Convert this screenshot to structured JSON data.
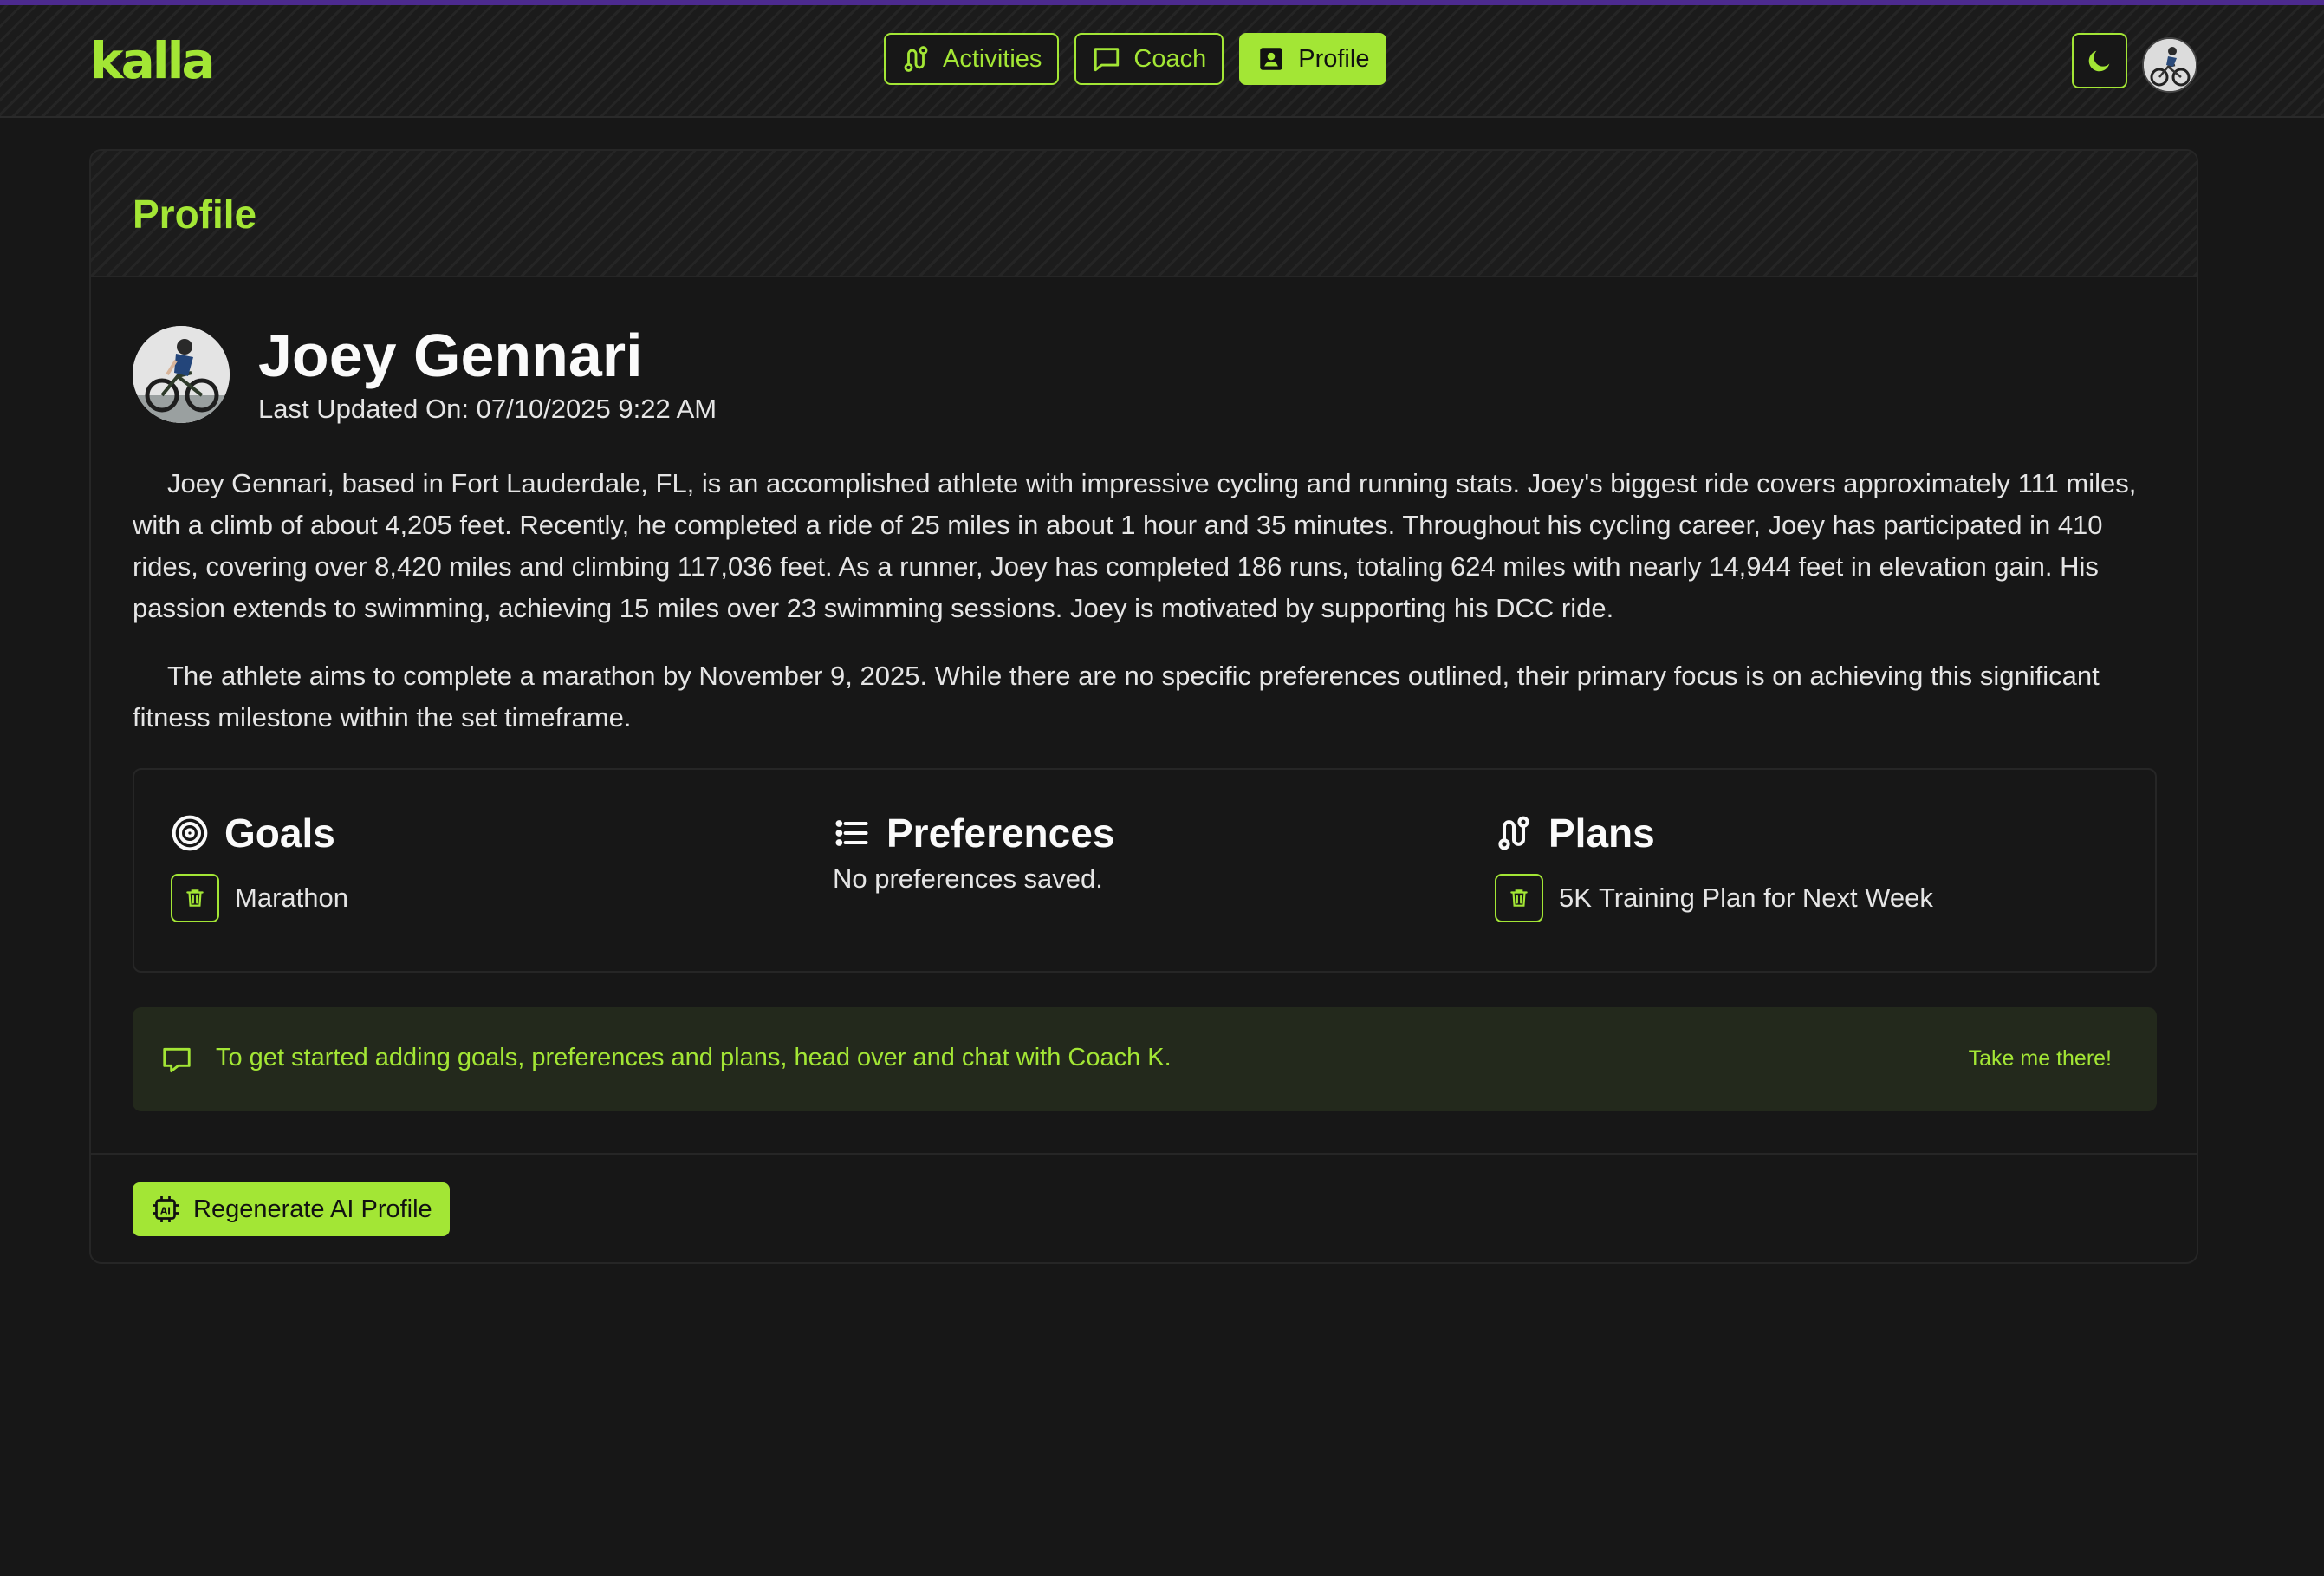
{
  "app": {
    "logo": "kalla"
  },
  "nav": {
    "items": [
      {
        "label": "Activities",
        "icon": "route-icon"
      },
      {
        "label": "Coach",
        "icon": "chat-icon"
      },
      {
        "label": "Profile",
        "icon": "contact-card-icon"
      }
    ],
    "active": "Profile"
  },
  "page": {
    "title": "Profile"
  },
  "profile": {
    "name": "Joey Gennari",
    "last_updated": "Last Updated On: 07/10/2025 9:22 AM",
    "bio": [
      "Joey Gennari, based in Fort Lauderdale, FL, is an accomplished athlete with impressive cycling and running stats. Joey's biggest ride covers approximately 111 miles, with a climb of about 4,205 feet. Recently, he completed a ride of 25 miles in about 1 hour and 35 minutes. Throughout his cycling career, Joey has participated in 410 rides, covering over 8,420 miles and climbing 117,036 feet. As a runner, Joey has completed 186 runs, totaling 624 miles with nearly 14,944 feet in elevation gain. His passion extends to swimming, achieving 15 miles over 23 swimming sessions. Joey is motivated by supporting his DCC ride.",
      "The athlete aims to complete a marathon by November 9, 2025. While there are no specific preferences outlined, their primary focus is on achieving this significant fitness milestone within the set timeframe."
    ]
  },
  "sections": {
    "goals": {
      "title": "Goals",
      "items": [
        "Marathon"
      ]
    },
    "preferences": {
      "title": "Preferences",
      "empty": "No preferences saved."
    },
    "plans": {
      "title": "Plans",
      "items": [
        "5K Training Plan for Next Week"
      ]
    }
  },
  "banner": {
    "text": "To get started adding goals, preferences and plans, head over and chat with Coach K.",
    "link": "Take me there!"
  },
  "actions": {
    "regenerate": "Regenerate AI Profile"
  },
  "colors": {
    "accent": "#a3e635",
    "background": "#171717",
    "banner_bg": "#23291c"
  }
}
